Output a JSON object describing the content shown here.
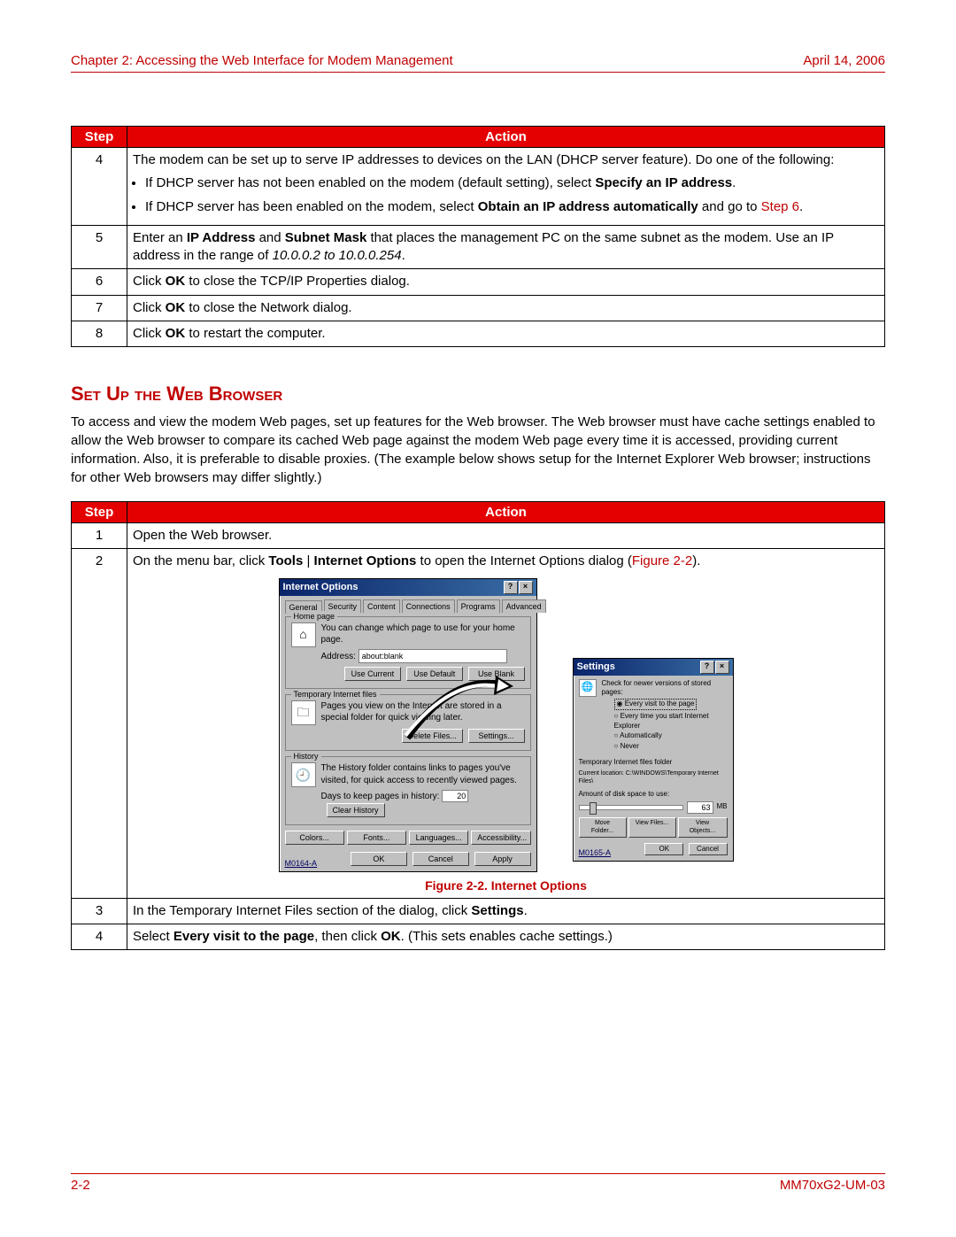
{
  "header": {
    "chapter": "Chapter 2: Accessing the Web Interface for Modem Management",
    "date": "April 14, 2006"
  },
  "table1": {
    "head_step": "Step",
    "head_action": "Action",
    "rows": {
      "r4": {
        "num": "4",
        "intro": "The modem can be set up to serve IP addresses to devices on the LAN (DHCP server feature). Do one of the following:",
        "b1a": "If DHCP server has not been enabled on the modem (default setting), select ",
        "b1b": "Specify an IP address",
        "b1c": ".",
        "b2a": "If DHCP server has been enabled on the modem, select ",
        "b2b": "Obtain an IP address automatically",
        "b2c": " and go to ",
        "b2d": "Step 6",
        "b2e": "."
      },
      "r5": {
        "num": "5",
        "a": "Enter an ",
        "b": "IP Address",
        "c": " and ",
        "d": "Subnet Mask",
        "e": " that places the management PC on the same subnet as the modem. Use an IP address in the range of ",
        "f": "10.0.0.2 to 10.0.0.254",
        "g": "."
      },
      "r6": {
        "num": "6",
        "a": "Click ",
        "b": "OK",
        "c": " to close the TCP/IP Properties dialog."
      },
      "r7": {
        "num": "7",
        "a": "Click ",
        "b": "OK",
        "c": " to close the Network dialog."
      },
      "r8": {
        "num": "8",
        "a": "Click ",
        "b": "OK",
        "c": " to restart the computer."
      }
    }
  },
  "section_heading": "Set Up the Web Browser",
  "section_para": "To access and view the modem Web pages, set up features for the Web browser. The Web browser must have cache settings enabled to allow the Web browser to compare its cached Web page against the modem Web page every time it is accessed, providing current information. Also, it is preferable to disable proxies. (The example below shows setup for the Internet Explorer Web browser; instructions for other Web browsers may differ slightly.)",
  "table2": {
    "head_step": "Step",
    "head_action": "Action",
    "r1": {
      "num": "1",
      "a": "Open the Web browser."
    },
    "r2": {
      "num": "2",
      "a": "On the menu bar, click ",
      "b": "Tools",
      "c": " | ",
      "d": "Internet Options",
      "e": " to open the Internet Options dialog (",
      "f": "Figure 2-2",
      "g": ")."
    },
    "fig_caption": "Figure 2-2. Internet Options",
    "r3": {
      "num": "3",
      "a": "In the Temporary Internet Files section of the dialog, click ",
      "b": "Settings",
      "c": "."
    },
    "r4": {
      "num": "4",
      "a": "Select ",
      "b": "Every visit to the page",
      "c": ", then click ",
      "d": "OK",
      "e": ". (This sets enables cache settings.)"
    }
  },
  "dialog_main": {
    "title": "Internet Options",
    "tabs": [
      "General",
      "Security",
      "Content",
      "Connections",
      "Programs",
      "Advanced"
    ],
    "homepage": {
      "legend": "Home page",
      "desc": "You can change which page to use for your home page.",
      "addr_label": "Address:",
      "addr_value": "about:blank",
      "btn_current": "Use Current",
      "btn_default": "Use Default",
      "btn_blank": "Use Blank"
    },
    "temp": {
      "legend": "Temporary Internet files",
      "desc": "Pages you view on the Internet are stored in a special folder for quick viewing later.",
      "btn_delete": "Delete Files...",
      "btn_settings": "Settings..."
    },
    "history": {
      "legend": "History",
      "desc": "The History folder contains links to pages you've visited, for quick access to recently viewed pages.",
      "days_label": "Days to keep pages in history:",
      "days_value": "20",
      "btn_clear": "Clear History"
    },
    "bottom": {
      "colors": "Colors...",
      "fonts": "Fonts...",
      "languages": "Languages...",
      "access": "Accessibility..."
    },
    "dlg_btns": {
      "ok": "OK",
      "cancel": "Cancel",
      "apply": "Apply"
    },
    "id": "M0164-A"
  },
  "dialog_settings": {
    "title": "Settings",
    "check_label": "Check for newer versions of stored pages:",
    "opt1": "Every visit to the page",
    "opt2": "Every time you start Internet Explorer",
    "opt3": "Automatically",
    "opt4": "Never",
    "temp_label": "Temporary Internet files folder",
    "loc": "Current location: C:\\WINDOWS\\Temporary Internet Files\\",
    "space_label": "Amount of disk space to use:",
    "space_value": "63",
    "space_unit": "MB",
    "btn_move": "Move Folder...",
    "btn_viewfiles": "View Files...",
    "btn_viewobj": "View Objects...",
    "ok": "OK",
    "cancel": "Cancel",
    "id": "M0165-A"
  },
  "footer": {
    "pagenum": "2-2",
    "docid": "MM70xG2-UM-03"
  }
}
